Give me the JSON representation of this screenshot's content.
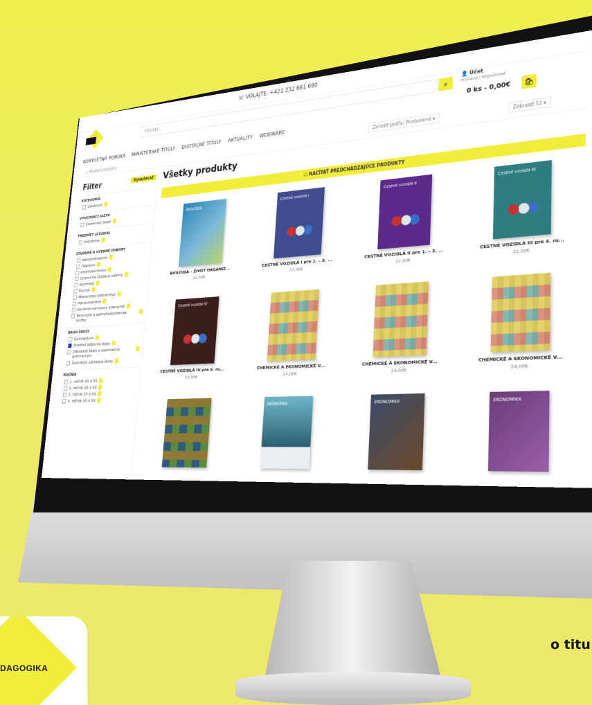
{
  "top": {
    "phone": "☏ VOLAJTE: +421 232 661 690"
  },
  "search": {
    "placeholder": "Hľadať..."
  },
  "user": {
    "name": "Účet",
    "sub": "Prihlásiť / Registrovať"
  },
  "cart": {
    "summary": "0 ks - 0,00€"
  },
  "nav": [
    "KOMPLETNÁ PONUKA",
    "MINISTERSKÉ TITULY",
    "DIGITÁLNE TITULY",
    "AKTUALITY",
    "WEBINÁRE"
  ],
  "sort": {
    "label": "Zoradiť podľa:",
    "value": "Predvolené"
  },
  "perpage": {
    "label": "Zobraziť",
    "value": "12"
  },
  "sidebar": {
    "search_placeholder": "Hľadať produkty",
    "filter_title": "Filter",
    "reset": "Vynulovať",
    "groups": [
      {
        "title": "KATEGÓRIA",
        "options": [
          {
            "label": "Učebnice",
            "checked": false
          }
        ]
      },
      {
        "title": "VYUČOVACÍ JAZYK",
        "options": [
          {
            "label": "Slovenský jazyk",
            "checked": false
          }
        ]
      },
      {
        "title": "PREDMET (ŠTÚDIA)",
        "options": [
          {
            "label": "Ekonómia",
            "checked": false
          }
        ]
      },
      {
        "title": "ŠTUDIJNÉ A UČEBNÉ ODBORY",
        "options": [
          {
            "label": "Agropodnikanie",
            "checked": false
          },
          {
            "label": "Doprava",
            "checked": false
          },
          {
            "label": "Elektrotechnika",
            "checked": false
          },
          {
            "label": "Chemická štúdijná odbory",
            "checked": false
          },
          {
            "label": "Kozmetik",
            "checked": false
          },
          {
            "label": "Kuchár",
            "checked": false
          },
          {
            "label": "Mäsiarstvo-údenárstvo",
            "checked": false
          },
          {
            "label": "Potravinárstvo",
            "checked": false
          },
          {
            "label": "Sociálno-výchovný pracovník",
            "checked": false
          },
          {
            "label": "Technické a poľnohospodárske služby",
            "checked": false
          }
        ]
      },
      {
        "title": "DRUH ŠKOLY",
        "options": [
          {
            "label": "Gymnázium",
            "checked": false
          },
          {
            "label": "Stredné odborné školy",
            "checked": true
          },
          {
            "label": "Základné školy a osemročné gymnázium",
            "checked": false
          },
          {
            "label": "Špeciálne základné školy",
            "checked": false
          }
        ]
      },
      {
        "title": "ROČNÍK",
        "options": [
          {
            "label": "1. ročník SŠ a SŠ",
            "checked": false
          },
          {
            "label": "2. ročník SŠ a SŠ",
            "checked": false
          },
          {
            "label": "3. ročník SŠ a SŠ",
            "checked": false
          },
          {
            "label": "4. ročník SŠ a SŠ",
            "checked": false
          }
        ]
      }
    ]
  },
  "main": {
    "title": "Všetky produkty",
    "banner": "☐ NAČÍTAŤ PREDCHÁDZAJÚCE PRODUKTY",
    "products": [
      {
        "name": "BIOLÓGIA – ŽIVOT ORGANIZ...",
        "price": "24,00€",
        "cover": "c-biology",
        "cover_label": "BIOLÓGIA"
      },
      {
        "name": "CESTNÉ VOZIDLÁ I pre 1. – 3. ...",
        "price": "22,00€",
        "cover": "c-blue",
        "cover_label": "Cestné vozidlá I"
      },
      {
        "name": "CESTNÉ VOZIDLÁ II pre 1. – 3. ...",
        "price": "22,00€",
        "cover": "c-purple",
        "cover_label": "Cestné vozidlá II"
      },
      {
        "name": "CESTNÉ VOZIDLÁ III pre 4. ro...",
        "price": "22,00€",
        "cover": "c-teal",
        "cover_label": "Cestné vozidlá III"
      },
      {
        "name": "CESTNÉ VOZIDLÁ IV pre 4. ro...",
        "price": "22,00€",
        "cover": "c-brown",
        "cover_label": "Cestné vozidlá IV"
      },
      {
        "name": "CHEMICKÉ A EKONOMICKÉ V...",
        "price": "24,00€",
        "cover": "c-mosaic",
        "cover_label": ""
      },
      {
        "name": "CHEMICKÉ A EKONOMICKÉ V...",
        "price": "24,00€",
        "cover": "c-mosaic",
        "cover_label": ""
      },
      {
        "name": "CHEMICKÉ A EKONOMICKÉ V...",
        "price": "24,00€",
        "cover": "c-mosaic",
        "cover_label": ""
      },
      {
        "name": "",
        "price": "",
        "cover": "c-mosaic-dark",
        "cover_label": ""
      },
      {
        "name": "",
        "price": "",
        "cover": "c-eco",
        "cover_label": "EKONÓMIA"
      },
      {
        "name": "",
        "price": "",
        "cover": "c-eko",
        "cover_label": "EKONOMIKA"
      },
      {
        "name": "",
        "price": "",
        "cover": "c-ekon",
        "cover_label": "EKONOMIKA"
      }
    ]
  },
  "brand": {
    "name": "DAGOGIKA"
  },
  "tagline": "o titu"
}
